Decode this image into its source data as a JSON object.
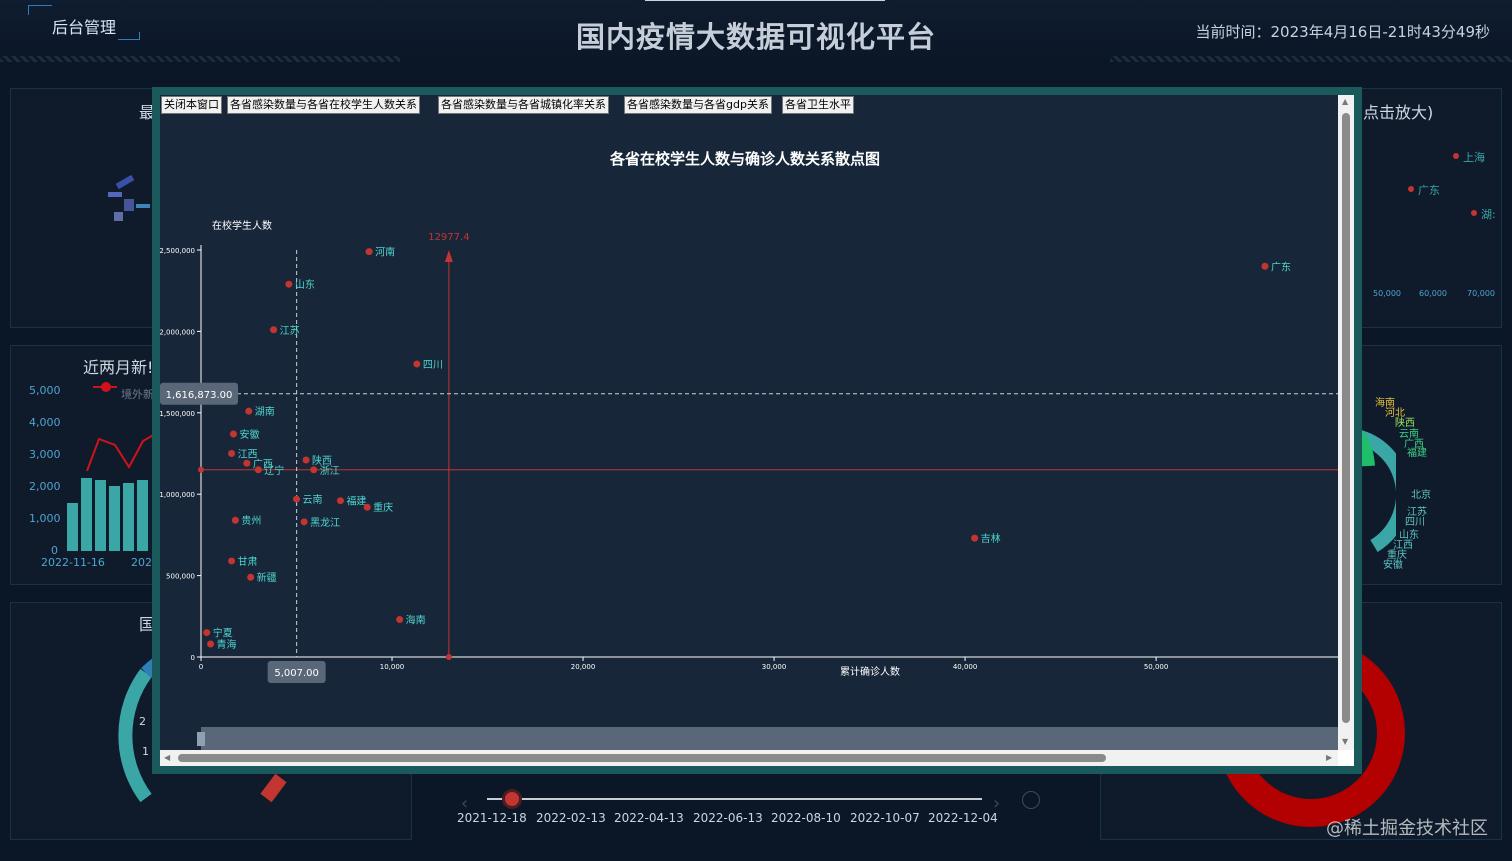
{
  "header": {
    "admin_label": "后台管理",
    "title": "国内疫情大数据可视化平台",
    "clock": "当前时间：2023年4月16日-21时43分49秒"
  },
  "background": {
    "panel_left_top_title": "最",
    "panel_right_top_title": "点击放大)",
    "panel_left_mid_title": "近两月新!",
    "legend_label": "境外新",
    "y_ticks": [
      "5,000",
      "4,000",
      "3,000",
      "2,000",
      "1,000",
      "0"
    ],
    "x_tick_1": "2022-11-16",
    "x_tick_2": "2022",
    "gauge_title": "国",
    "right_top_labels": [
      "上海",
      "广东",
      "湖:"
    ],
    "right_top_ticks": [
      "50,000",
      "60,000",
      "70,000"
    ],
    "right_mid_labels": [
      "海南",
      "河北",
      "陕西",
      "云南",
      "广西",
      "福建",
      "北京",
      "江苏",
      "四川",
      "山东",
      "江西",
      "重庆",
      "安徽"
    ],
    "timeline_dates": [
      "2021-12-18",
      "2022-02-13",
      "2022-04-13",
      "2022-06-13",
      "2022-08-10",
      "2022-10-07",
      "2022-12-04"
    ],
    "gauge_ticks": [
      "2",
      "1"
    ]
  },
  "modal": {
    "tabs": [
      "关闭本窗口",
      "各省感染数量与各省在校学生人数关系",
      "各省感染数量与各省城镇化率关系",
      "各省感染数量与各省gdp关系",
      "各省卫生水平"
    ]
  },
  "chart_data": {
    "type": "scatter",
    "title": "各省在校学生人数与确诊人数关系散点图",
    "xlabel": "累计确诊人数",
    "ylabel": "在校学生人数",
    "xlim": [
      0,
      59000
    ],
    "ylim": [
      0,
      2500000
    ],
    "x_ticks": [
      0,
      10000,
      20000,
      30000,
      40000,
      50000
    ],
    "x_tick_labels": [
      "0",
      "10,000",
      "20,000",
      "30,000",
      "40,000",
      "50,000"
    ],
    "y_ticks": [
      0,
      500000,
      1000000,
      1500000,
      2000000,
      2500000
    ],
    "y_tick_labels": [
      "0",
      "500,000",
      "1,000,000",
      "1,500,000",
      "2,000,000",
      "2,500,000"
    ],
    "points": [
      {
        "name": "河南",
        "x": 8800,
        "y": 2490000
      },
      {
        "name": "广东",
        "x": 55700,
        "y": 2400000
      },
      {
        "name": "山东",
        "x": 4600,
        "y": 2290000
      },
      {
        "name": "江苏",
        "x": 3800,
        "y": 2010000
      },
      {
        "name": "四川",
        "x": 11300,
        "y": 1800000
      },
      {
        "name": "湖南",
        "x": 2500,
        "y": 1510000
      },
      {
        "name": "安徽",
        "x": 1700,
        "y": 1370000
      },
      {
        "name": "江西",
        "x": 1600,
        "y": 1250000
      },
      {
        "name": "广西",
        "x": 2400,
        "y": 1190000
      },
      {
        "name": "辽宁",
        "x": 3000,
        "y": 1150000
      },
      {
        "name": "陕西",
        "x": 5500,
        "y": 1210000
      },
      {
        "name": "浙江",
        "x": 5900,
        "y": 1150000
      },
      {
        "name": "云南",
        "x": 5000,
        "y": 970000
      },
      {
        "name": "福建",
        "x": 7300,
        "y": 960000
      },
      {
        "name": "重庆",
        "x": 8700,
        "y": 920000
      },
      {
        "name": "贵州",
        "x": 1800,
        "y": 840000
      },
      {
        "name": "黑龙江",
        "x": 5400,
        "y": 830000
      },
      {
        "name": "吉林",
        "x": 40500,
        "y": 730000
      },
      {
        "name": "甘肃",
        "x": 1600,
        "y": 590000
      },
      {
        "name": "新疆",
        "x": 2600,
        "y": 490000
      },
      {
        "name": "海南",
        "x": 10400,
        "y": 230000
      },
      {
        "name": "宁夏",
        "x": 300,
        "y": 150000
      },
      {
        "name": "青海",
        "x": 500,
        "y": 80000
      }
    ],
    "mean_line_x": 12977.4,
    "mean_line_x_label": "12977.4",
    "mean_line_y": 1150000,
    "cursor_x": 5007,
    "cursor_x_label": "5,007.00",
    "cursor_y": 1616873,
    "cursor_y_label": "1,616,873.00",
    "colors": {
      "point": "#c23531",
      "label": "#4fd6d0",
      "axis": "#ffffff",
      "mark_line": "#c23531"
    }
  },
  "watermark": "@稀土掘金技术社区"
}
